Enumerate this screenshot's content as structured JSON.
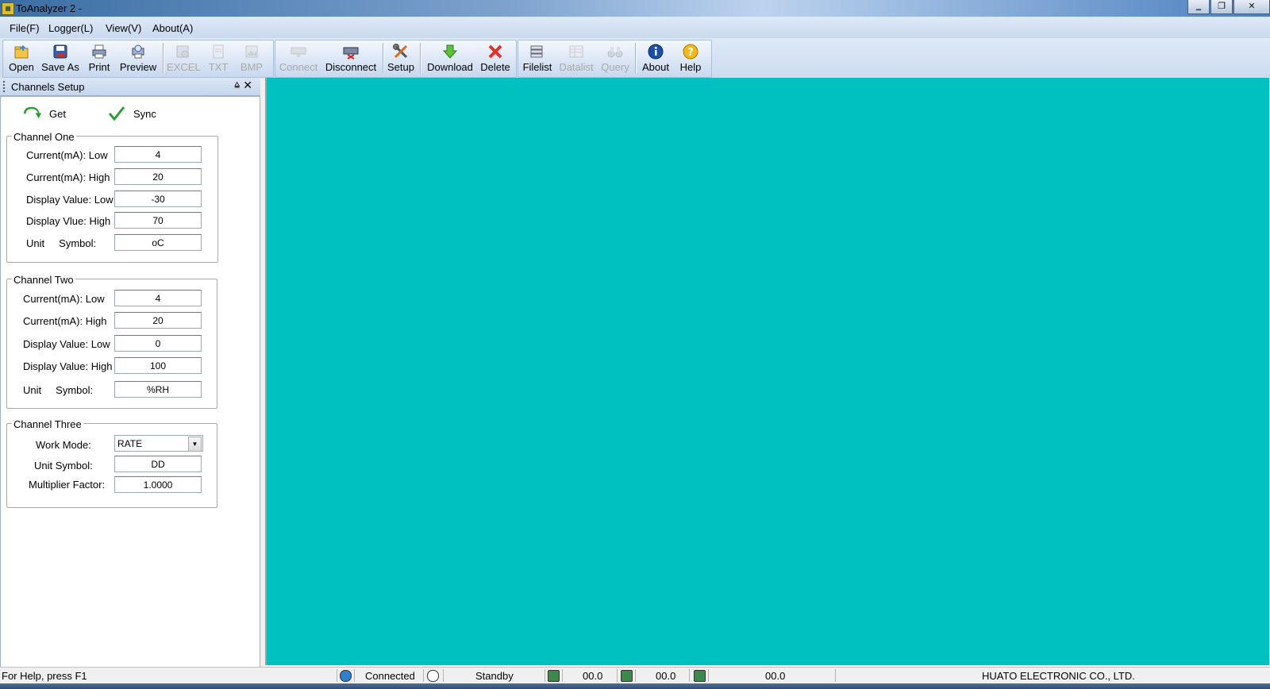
{
  "window": {
    "title": "ToAnalyzer 2 -",
    "minimize": "‗",
    "restore": "❐",
    "close": "✕"
  },
  "menu": [
    "File(F)",
    "Logger(L)",
    "View(V)",
    "About(A)"
  ],
  "toolbar": {
    "open": "Open",
    "save_as": "Save As",
    "print": "Print",
    "preview": "Preview",
    "excel": "EXCEL",
    "txt": "TXT",
    "bmp": "BMP",
    "connect": "Connect",
    "disconnect": "Disconnect",
    "setup": "Setup",
    "download": "Download",
    "delete": "Delete",
    "filelist": "Filelist",
    "datalist": "Datalist",
    "query": "Query",
    "about": "About",
    "help": "Help"
  },
  "panel": {
    "title": "Channels Setup",
    "pin": "⩠",
    "close": "✕",
    "get": "Get",
    "sync": "Sync"
  },
  "channel_one": {
    "title": "Channel One",
    "fields": [
      {
        "label": "Current(mA): Low",
        "value": "4"
      },
      {
        "label": "Current(mA): High",
        "value": "20"
      },
      {
        "label": "Display Value: Low",
        "value": "-30"
      },
      {
        "label": "Display Vlue: High",
        "value": "70"
      },
      {
        "label": "Unit     Symbol:",
        "value": "oC"
      }
    ]
  },
  "channel_two": {
    "title": "Channel Two",
    "fields": [
      {
        "label": "Current(mA): Low",
        "value": "4"
      },
      {
        "label": "Current(mA): High",
        "value": "20"
      },
      {
        "label": "Display Value: Low",
        "value": "0"
      },
      {
        "label": "Display Value: High",
        "value": "100"
      },
      {
        "label": "Unit     Symbol:",
        "value": "%RH"
      }
    ]
  },
  "channel_three": {
    "title": "Channel Three",
    "work_mode_label": "Work Mode:",
    "work_mode_value": "RATE",
    "unit_symbol_label": "Unit Symbol:",
    "unit_symbol_value": "DD",
    "multiplier_label": "Multiplier Factor:",
    "multiplier_value": "1.0000"
  },
  "status": {
    "help": "For Help, press F1",
    "connection": "Connected",
    "state": "Standby",
    "reading1": "00.0",
    "reading2": "00.0",
    "reading3": "00.0",
    "company": "HUATO ELECTRONIC CO., LTD."
  },
  "colors": {
    "main_area": "#00c0c0",
    "delete_icon": "#e0322b",
    "download_icon": "#5fbf3c",
    "about_icon": "#1d4fa8",
    "help_icon": "#f2b81c"
  }
}
